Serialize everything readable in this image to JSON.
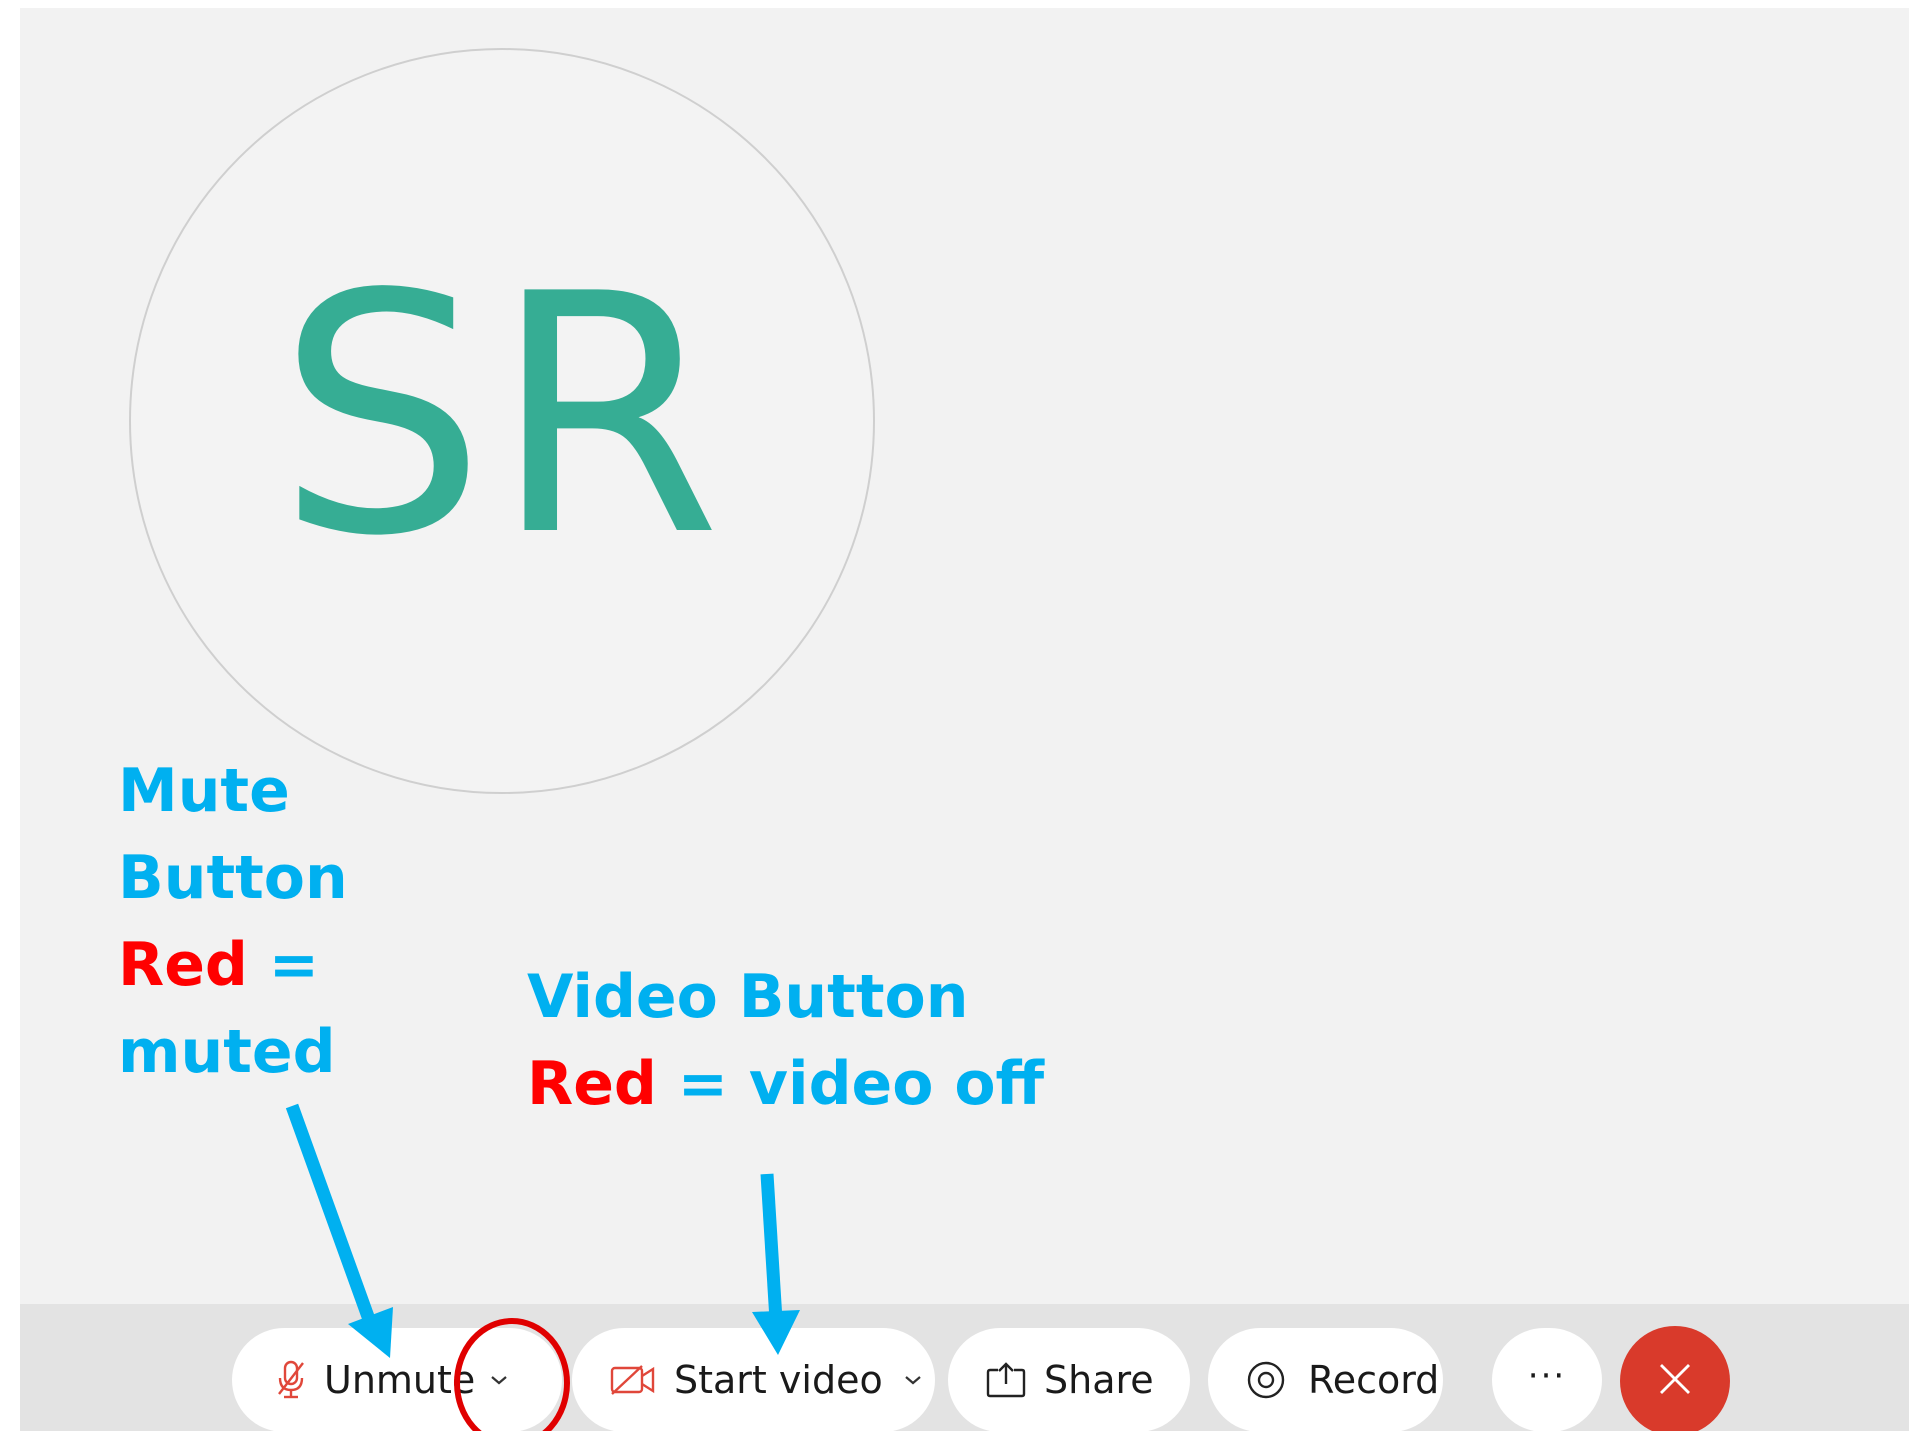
{
  "avatar": {
    "initials": "SR",
    "color": "#36ad94"
  },
  "annotations": {
    "mute": {
      "line1": "Mute",
      "line2": "Button",
      "red_word": "Red",
      "equals": " =",
      "line4": "muted"
    },
    "video": {
      "line1": "Video Button",
      "red_word": "Red",
      "rest": " = video off"
    },
    "text_color": "#00b0f0",
    "red_color": "#ff0000"
  },
  "toolbar": {
    "unmute_label": "Unmute",
    "start_video_label": "Start video",
    "share_label": "Share",
    "record_label": "Record",
    "more_label": "···",
    "icons": {
      "unmute": "microphone-off-icon",
      "video": "video-off-icon",
      "share": "share-icon",
      "record": "record-icon",
      "chevron": "chevron-down-icon",
      "leave": "close-icon"
    },
    "muted_color": "#e0473a",
    "leave_color": "#d93a2b"
  }
}
